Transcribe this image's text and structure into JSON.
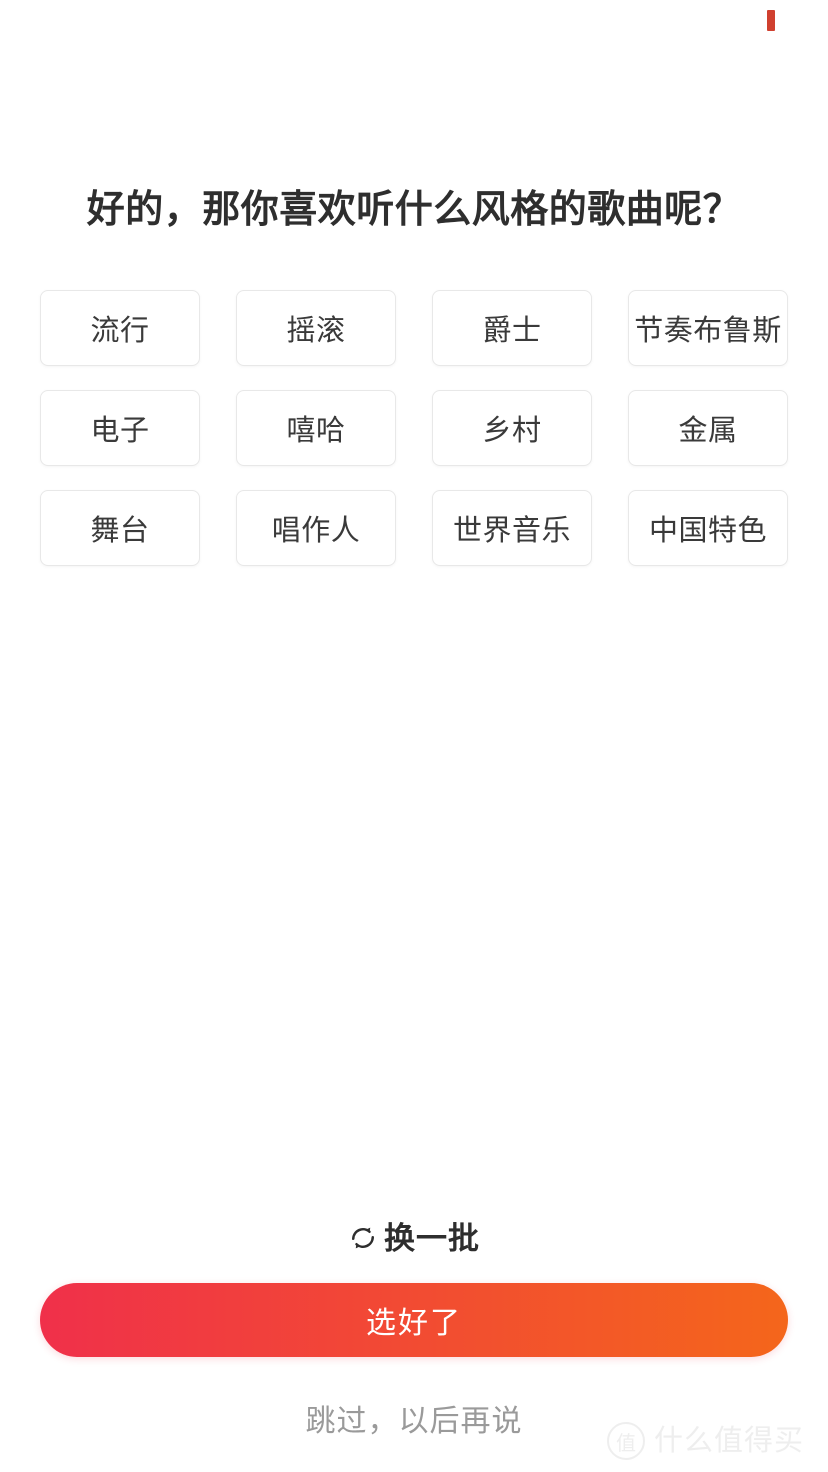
{
  "status_bar": {
    "indicator_color": "#d0402f",
    "indicator_name": "status-indicator"
  },
  "header": {
    "title": "好的，那你喜欢听什么风格的歌曲呢？"
  },
  "genres": {
    "columns": 4,
    "items": [
      {
        "label": "流行",
        "selected": false
      },
      {
        "label": "摇滚",
        "selected": false
      },
      {
        "label": "爵士",
        "selected": false
      },
      {
        "label": "节奏布鲁斯",
        "selected": false
      },
      {
        "label": "电子",
        "selected": false
      },
      {
        "label": "嘻哈",
        "selected": false
      },
      {
        "label": "乡村",
        "selected": false
      },
      {
        "label": "金属",
        "selected": false
      },
      {
        "label": "舞台",
        "selected": false
      },
      {
        "label": "唱作人",
        "selected": false
      },
      {
        "label": "世界音乐",
        "selected": false
      },
      {
        "label": "中国特色",
        "selected": false
      }
    ]
  },
  "footer": {
    "refresh_label": "换一批",
    "refresh_icon": "refresh-icon",
    "confirm_label": "选好了",
    "skip_label": "跳过，以后再说"
  },
  "theme": {
    "gradient_start": "#F0304A",
    "gradient_end": "#F4661B",
    "tag_border": "#e8e8e8",
    "tag_text": "#3a3a3a",
    "title_text": "#2e2e2e",
    "skip_text": "#9a9a9a"
  },
  "watermark": {
    "badge": "值",
    "text": "什么值得买"
  }
}
